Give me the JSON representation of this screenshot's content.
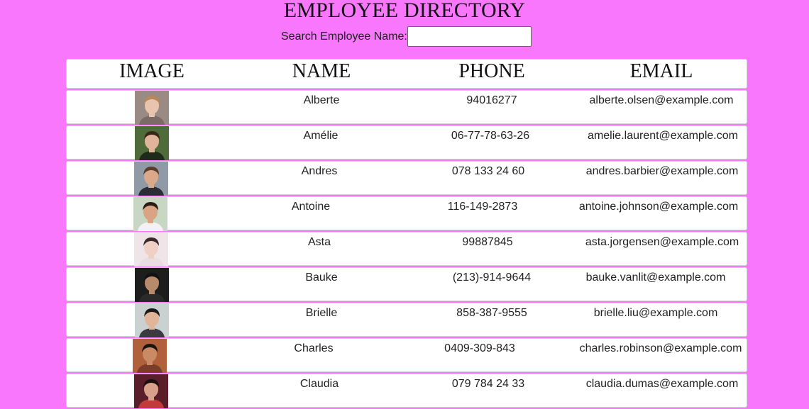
{
  "page": {
    "title": "EMPLOYEE DIRECTORY"
  },
  "search": {
    "label": "Search Employee Name:",
    "value": "",
    "placeholder": ""
  },
  "table": {
    "headers": {
      "image": "IMAGE",
      "name": "NAME",
      "phone": "PHONE",
      "email": "EMAIL"
    },
    "rows": [
      {
        "name": "Alberte",
        "phone": "94016277",
        "email": "alberte.olsen@example.com",
        "photo": {
          "bg": "#9a8a84",
          "skin": "#e8c4ae",
          "hair": "#b8875a",
          "shirt": "#7c6a66"
        }
      },
      {
        "name": "Amélie",
        "phone": "06-77-78-63-26",
        "email": "amelie.laurent@example.com",
        "photo": {
          "bg": "#4f6b3a",
          "skin": "#e0b49a",
          "hair": "#3a2518",
          "shirt": "#1e2b1a"
        }
      },
      {
        "name": "Andres",
        "phone": "078 133 24 60",
        "email": "andres.barbier@example.com",
        "photo": {
          "bg": "#8f9aa6",
          "skin": "#d9a98a",
          "hair": "#5a3d2a",
          "shirt": "#2a2d35"
        }
      },
      {
        "name": "Antoine",
        "phone": "116-149-2873",
        "email": "antoine.johnson@example.com",
        "photo": {
          "bg": "#c8d6c4",
          "skin": "#d8a483",
          "hair": "#2a1c14",
          "shirt": "#f2f2f2"
        }
      },
      {
        "name": "Asta",
        "phone": "99887845",
        "email": "asta.jorgensen@example.com",
        "photo": {
          "bg": "#efe5e8",
          "skin": "#f0cfc5",
          "hair": "#3b2a2a",
          "shirt": "#e9dde2"
        }
      },
      {
        "name": "Bauke",
        "phone": "(213)-914-9644",
        "email": "bauke.vanlit@example.com",
        "photo": {
          "bg": "#1d1d1d",
          "skin": "#b88a6c",
          "hair": "#111111",
          "shirt": "#2a2a2a"
        }
      },
      {
        "name": "Brielle",
        "phone": "858-387-9555",
        "email": "brielle.liu@example.com",
        "photo": {
          "bg": "#c9d1d1",
          "skin": "#e0b59a",
          "hair": "#1a1a1a",
          "shirt": "#3a3a40"
        }
      },
      {
        "name": "Charles",
        "phone": "0409-309-843",
        "email": "charles.robinson@example.com",
        "photo": {
          "bg": "#b0603a",
          "skin": "#c98a66",
          "hair": "#1c1410",
          "shirt": "#7a3d2a"
        }
      },
      {
        "name": "Claudia",
        "phone": "079 784 24 33",
        "email": "claudia.dumas@example.com",
        "photo": {
          "bg": "#5a1e2a",
          "skin": "#d9a08a",
          "hair": "#1a0f0f",
          "shirt": "#c23a3a"
        }
      }
    ]
  }
}
